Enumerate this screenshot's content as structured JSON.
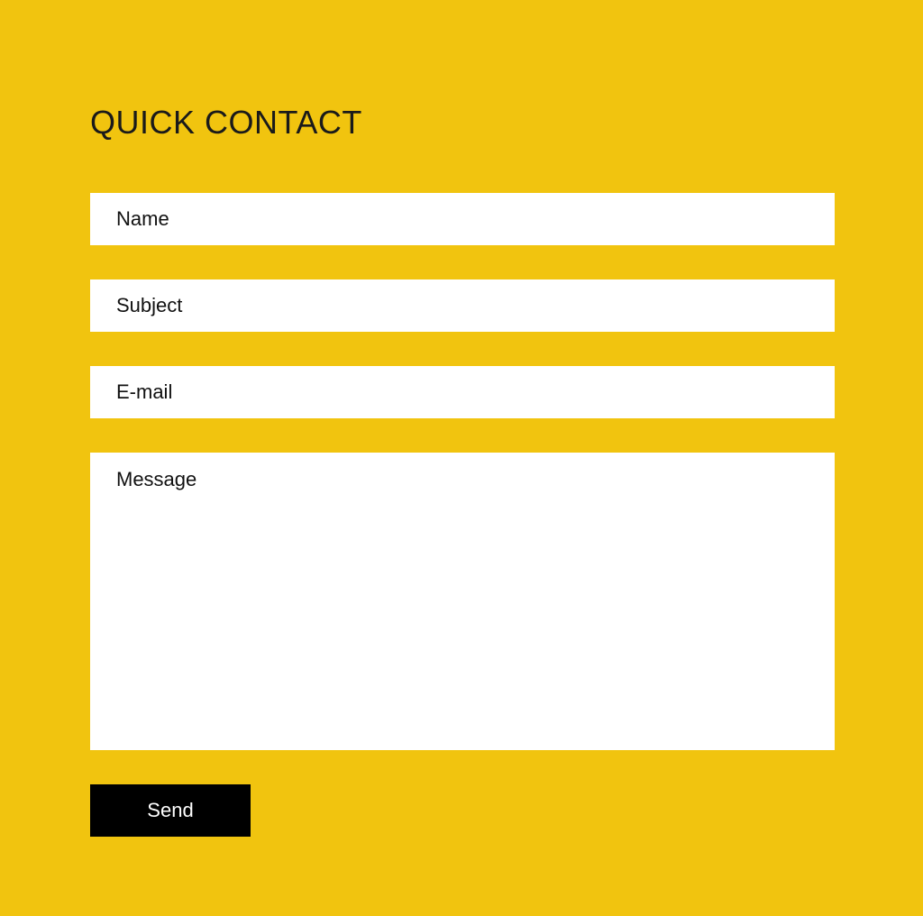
{
  "colors": {
    "background": "#F1C40F",
    "field_background": "#FFFFFF",
    "button_background": "#000000",
    "button_text": "#FFFFFF"
  },
  "form": {
    "title": "QUICK CONTACT",
    "fields": {
      "name": {
        "placeholder": "Name",
        "value": ""
      },
      "subject": {
        "placeholder": "Subject",
        "value": ""
      },
      "email": {
        "placeholder": "E-mail",
        "value": ""
      },
      "message": {
        "placeholder": "Message",
        "value": ""
      }
    },
    "submit_label": "Send"
  }
}
